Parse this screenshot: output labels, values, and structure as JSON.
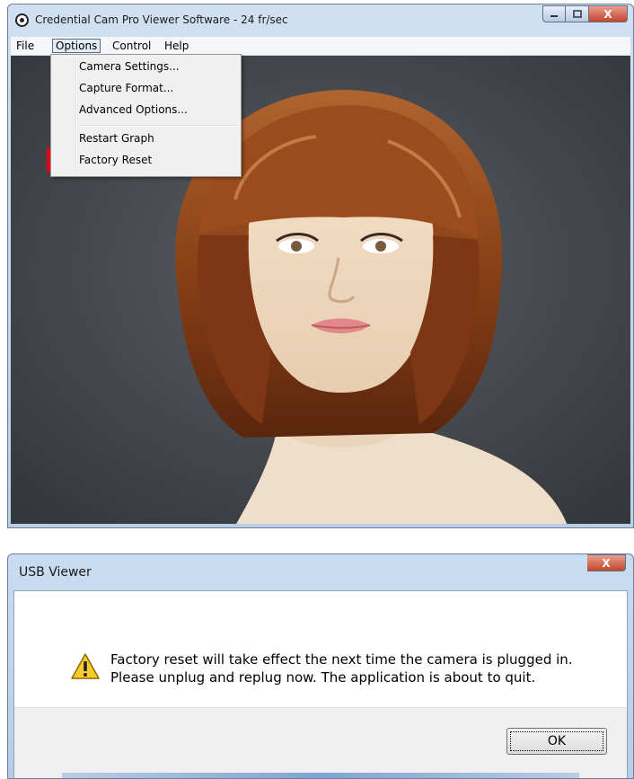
{
  "viewer_window": {
    "title": "Credential Cam Pro Viewer Software - 24 fr/sec",
    "menu": [
      "File",
      "Options",
      "Control",
      "Help"
    ],
    "options_menu": {
      "items": [
        "Camera Settings...",
        "Capture Format...",
        "Advanced Options...",
        "Restart Graph",
        "Factory Reset"
      ],
      "highlighted": "Factory Reset"
    },
    "highlight_color": "#e0001b"
  },
  "dialog": {
    "title": "USB Viewer",
    "message_line1": "Factory reset will take effect the next time the camera is plugged in.",
    "message_line2": "Please unplug and replug now.  The application is about to quit.",
    "ok_label": "OK",
    "icon": "warning-icon"
  },
  "caption_buttons": {
    "close": "X"
  }
}
